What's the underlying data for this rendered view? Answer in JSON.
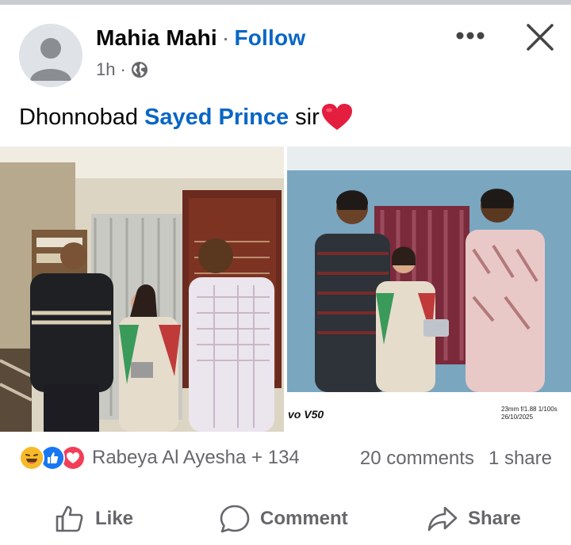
{
  "post": {
    "author": "Mahia Mahi",
    "separator": "·",
    "follow": "Follow",
    "time": "1h",
    "time_separator": "·",
    "caption_before": "Dhonnobad",
    "caption_mention": "Sayed Prince",
    "caption_after": "sir",
    "photo_watermark_left": "vo V50",
    "photo_watermark_right_line1": "23mm f/1.88 1/100s",
    "photo_watermark_right_line2": "26/10/2025"
  },
  "reactions": {
    "names": "Rabeya Al Ayesha + 134",
    "comments": "20 comments",
    "shares": "1 share"
  },
  "actions": {
    "like": "Like",
    "comment": "Comment",
    "share": "Share"
  },
  "colors": {
    "link": "#0866c6",
    "secondary_text": "#65676b",
    "heart": "#e41e3f",
    "like_blue": "#1877f2",
    "haha_yellow": "#f7b928"
  },
  "icons": {
    "more": "more-horizontal-icon",
    "close": "close-icon",
    "privacy": "globe-icon",
    "like": "thumbs-up-icon",
    "comment": "speech-bubble-icon",
    "share": "share-arrow-icon"
  }
}
